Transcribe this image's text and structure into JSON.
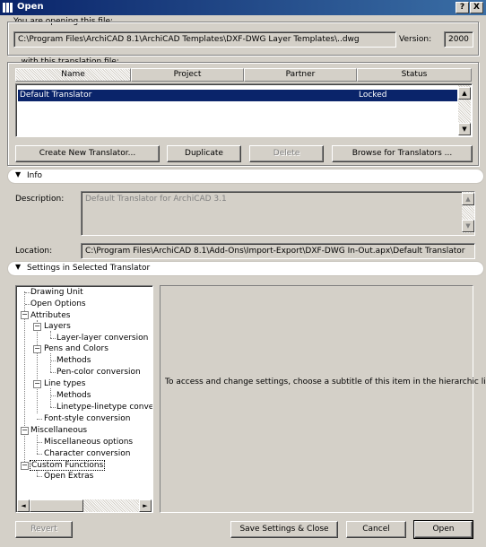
{
  "window": {
    "title": "Open",
    "help_label": "?",
    "close_label": "X"
  },
  "file": {
    "group_label": "You are opening this file:",
    "path": "C:\\Program Files\\ArchiCAD 8.1\\ArchiCAD Templates\\DXF-DWG Layer Templates\\..dwg",
    "version_label": "Version:",
    "version": "2000"
  },
  "translator": {
    "group_label": "...with this translation file:",
    "columns": [
      "Name",
      "Project",
      "Partner",
      "Status"
    ],
    "rows": [
      {
        "name": "Default Translator",
        "project": "",
        "partner": "",
        "status": "Locked"
      }
    ],
    "buttons": {
      "create": "Create New Translator...",
      "duplicate": "Duplicate",
      "delete": "Delete",
      "browse": "Browse for Translators ..."
    }
  },
  "info": {
    "header": "Info",
    "description_label": "Description:",
    "description": "Default Translator for ArchiCAD 3.1",
    "location_label": "Location:",
    "location": "C:\\Program Files\\ArchiCAD 8.1\\Add-Ons\\Import-Export\\DXF-DWG In-Out.apx\\Default Translator"
  },
  "settings": {
    "header": "Settings in Selected Translator",
    "tree": [
      "Drawing Unit",
      "Open Options",
      "Attributes",
      "Layers",
      "Layer-layer conversion",
      "Pens and Colors",
      "Methods",
      "Pen-color conversion",
      "Line types",
      "Methods",
      "Linetype-linetype conversion",
      "Font-style conversion",
      "Miscellaneous",
      "Miscellaneous options",
      "Character conversion",
      "Custom Functions",
      "Open Extras"
    ],
    "hint": "To access and change settings, choose a subtitle of this item in the hierarchic list."
  },
  "footer": {
    "revert": "Revert",
    "save_close": "Save Settings & Close",
    "cancel": "Cancel",
    "open": "Open"
  }
}
